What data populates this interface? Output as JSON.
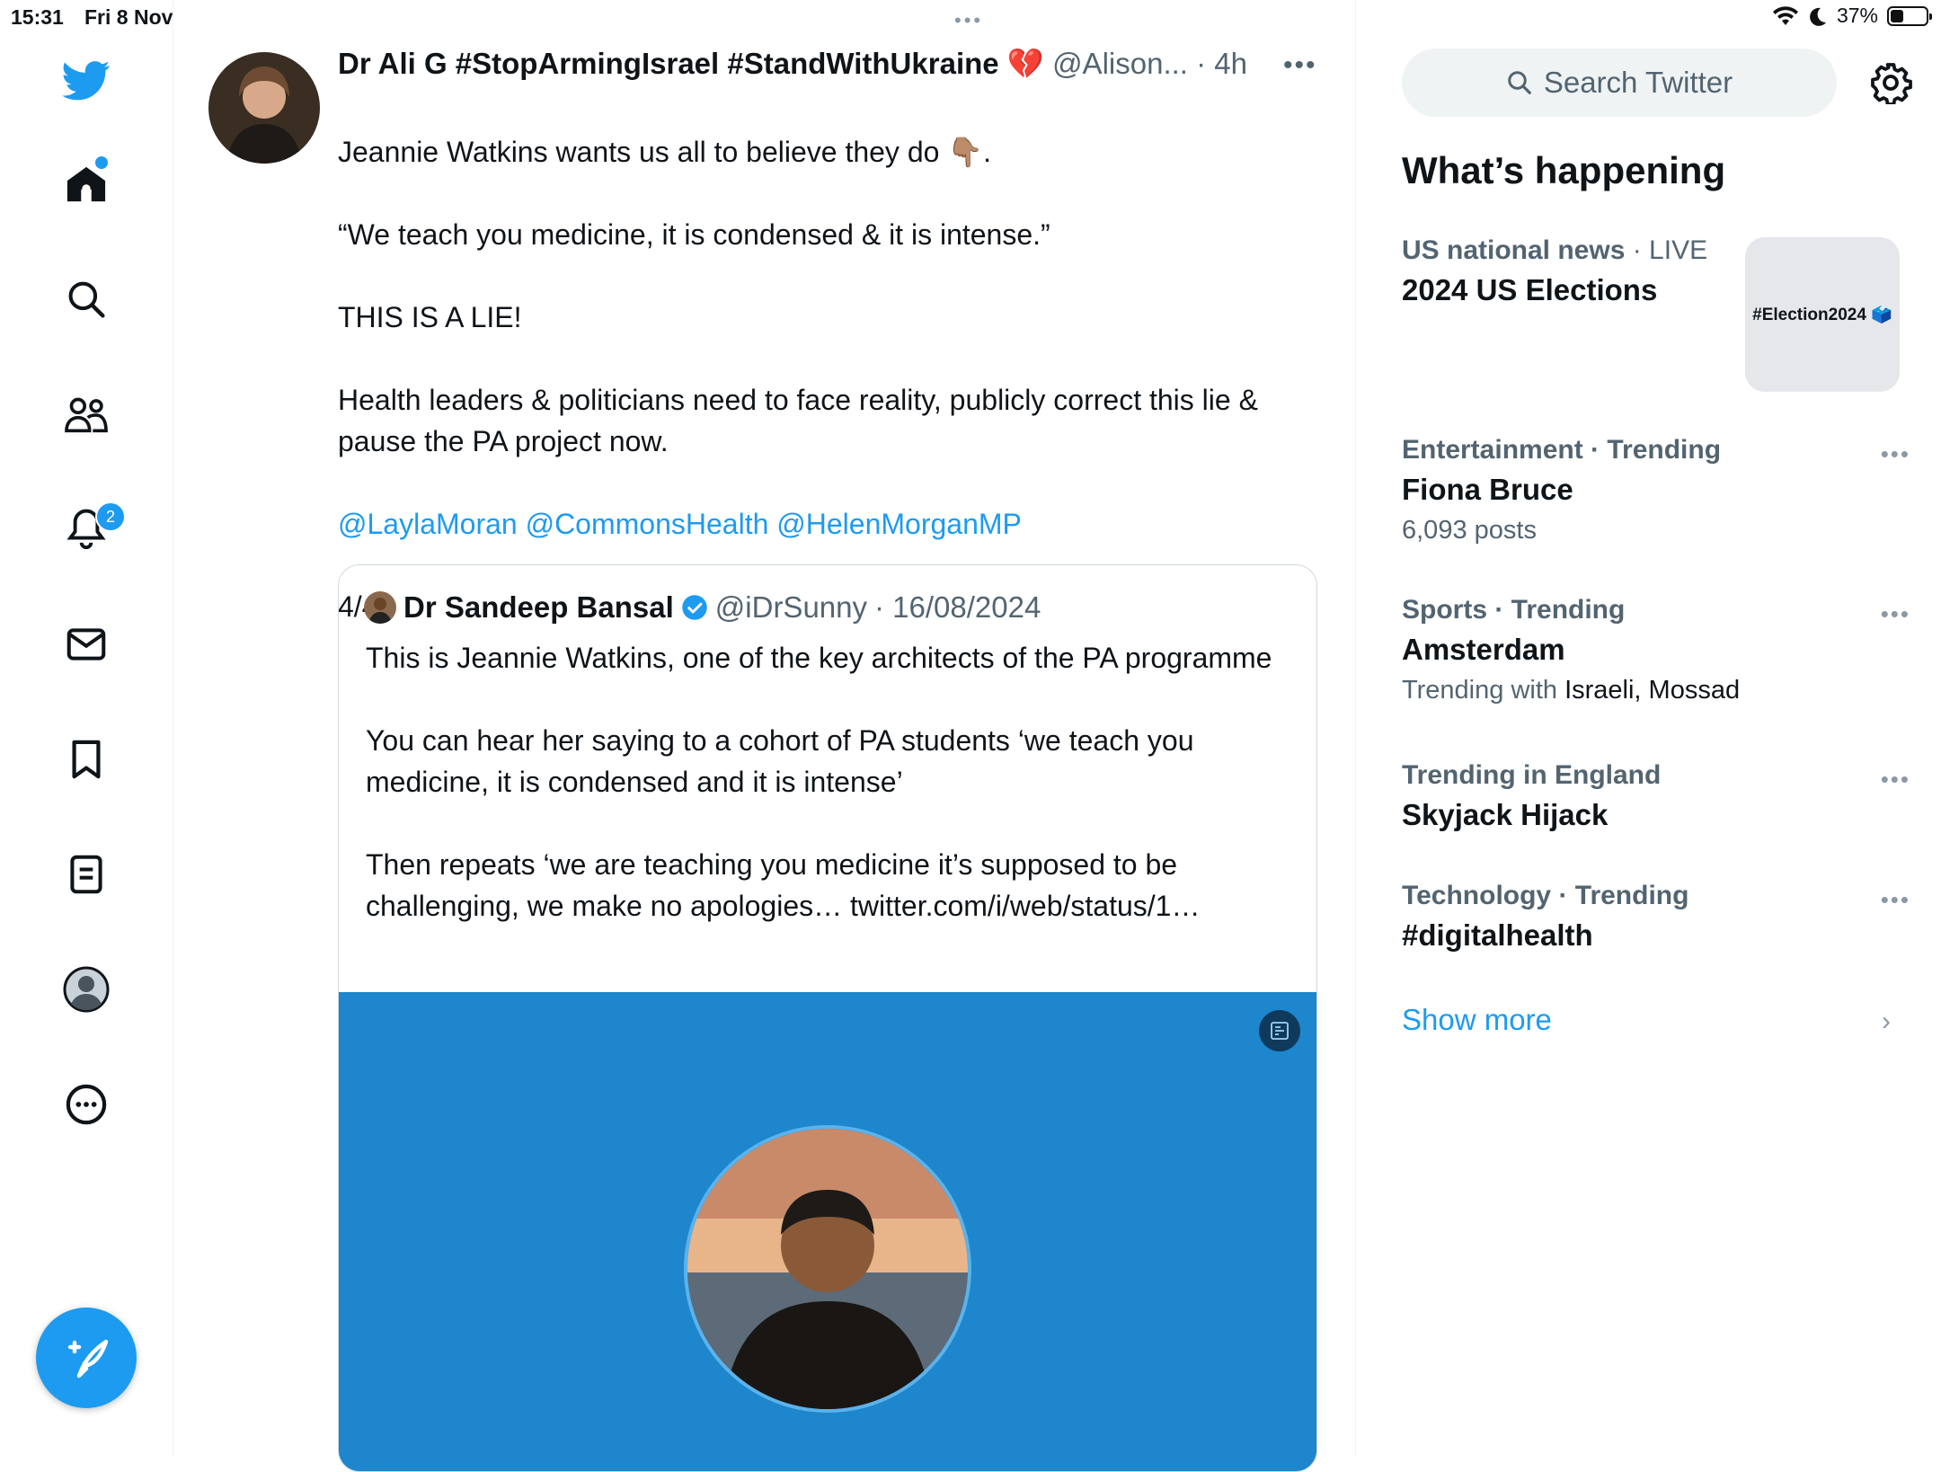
{
  "status_bar": {
    "time": "15:31",
    "date": "Fri 8 Nov",
    "battery": "37%",
    "battery_fraction": 0.37
  },
  "nav": {
    "notifications_badge": "2"
  },
  "tweet": {
    "name": "Dr Ali G #StopArmingIsrael #StandWithUkraine 💔",
    "handle": "@Alison...",
    "time": "· 4h",
    "text": "Jeannie Watkins wants us all to believe they do 👇🏽.\n\n“We teach you medicine, it is condensed & it is intense.”\n\nTHIS IS A LIE!\n\nHealth leaders & politicians need to face reality, publicly correct this lie & pause the PA project now.\n",
    "mentions": "@LaylaMoran @CommonsHealth @HelenMorganMP",
    "counter": "4/4"
  },
  "quote": {
    "name": "Dr Sandeep Bansal",
    "handle": "@iDrSunny",
    "date": "· 16/08/2024",
    "text": "This is Jeannie Watkins, one of the key architects of the PA programme\n\nYou can hear her saying to a cohort of PA students ‘we teach you medicine, it is condensed and it is intense’\n\nThen repeats ‘we are teaching you medicine it’s supposed to be challenging, we make no apologies… twitter.com/i/web/status/1…"
  },
  "sidebar": {
    "search_placeholder": "Search Twitter",
    "title": "What’s happening",
    "trends": [
      {
        "category": "US national news",
        "tag": " · LIVE",
        "title": "2024 US Elections",
        "image_text": "#Election2024 🗳️"
      },
      {
        "category": "Entertainment · Trending",
        "title": "Fiona Bruce",
        "sub": "6,093 posts"
      },
      {
        "category": "Sports · Trending",
        "title": "Amsterdam",
        "sub_prefix": "Trending with ",
        "sub_bold": "Israeli, Mossad"
      },
      {
        "category": "Trending in England",
        "title": "Skyjack Hijack"
      },
      {
        "category": "Technology · Trending",
        "title": "#digitalhealth"
      }
    ],
    "show_more": "Show more"
  }
}
